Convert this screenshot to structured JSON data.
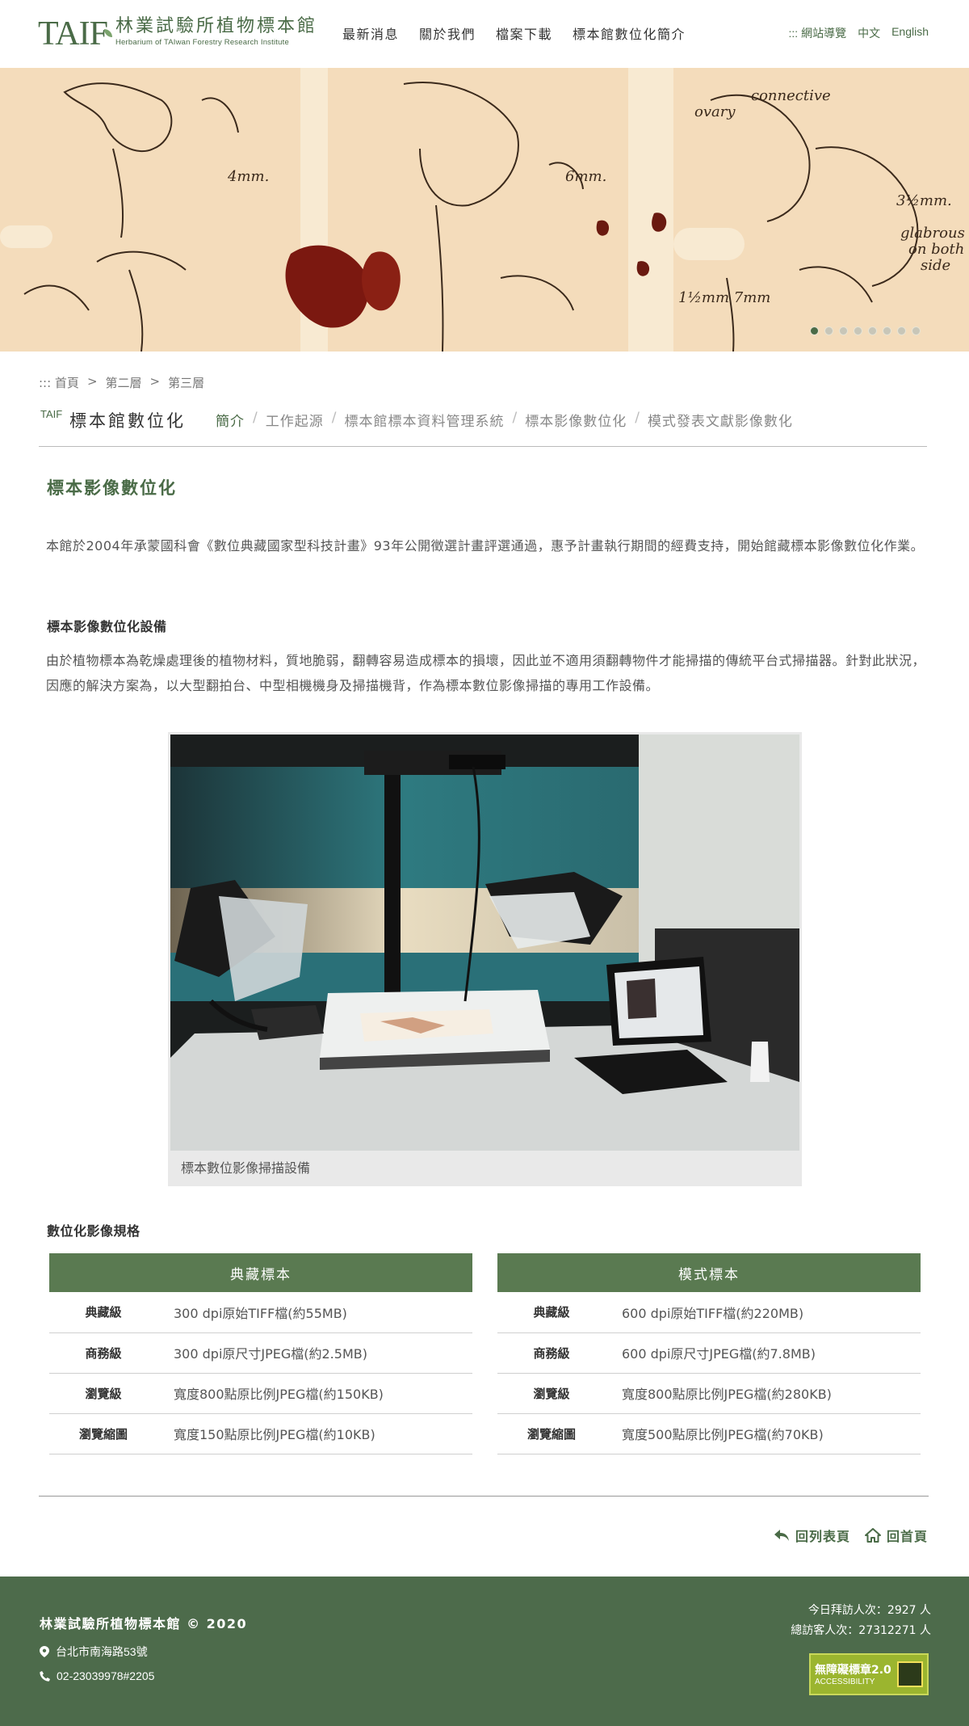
{
  "header": {
    "logo_mark": "TAIF",
    "logo_cn": "林業試驗所植物標本館",
    "logo_en": "Herbarium of TAIwan Forestry Research Institute",
    "nav": [
      "最新消息",
      "關於我們",
      "檔案下載",
      "標本館數位化簡介"
    ],
    "top_links": [
      ":::  網站導覽",
      "中文",
      "English"
    ]
  },
  "banner": {
    "slide_count": 8,
    "active_slide": 1
  },
  "breadcrumb": [
    ":::  首頁",
    ">",
    "第二層",
    ">",
    "第三層"
  ],
  "section": {
    "tag": "TAIF",
    "title": "標本館數位化",
    "tabs": [
      "簡介",
      "工作起源",
      "標本館標本資料管理系統",
      "標本影像數位化",
      "模式發表文獻影像數化"
    ],
    "active_tab": 0
  },
  "content": {
    "heading": "標本影像數位化",
    "para1": "本館於2004年承蒙國科會《數位典藏國家型科技計畫》93年公開徵選計畫評選通過，惠予計畫執行期間的經費支持，開始館藏標本影像數位化作業。",
    "sub1": "標本影像數位化設備",
    "para2": "由於植物標本為乾燥處理後的植物材料，質地脆弱，翻轉容易造成標本的損壞，因此並不適用須翻轉物件才能掃描的傳統平台式掃描器。針對此狀況，因應的解決方案為，以大型翻拍台、中型相機機身及掃描機背，作為標本數位影像掃描的專用工作設備。",
    "caption": "標本數位影像掃描設備",
    "sub2": "數位化影像規格"
  },
  "tables": {
    "left": {
      "title": "典藏標本",
      "rows": [
        [
          "典藏級",
          "300 dpi原始TIFF檔(約55MB)"
        ],
        [
          "商務級",
          "300 dpi原尺寸JPEG檔(約2.5MB)"
        ],
        [
          "瀏覽級",
          "寬度800點原比例JPEG檔(約150KB)"
        ],
        [
          "瀏覽縮圖",
          "寬度150點原比例JPEG檔(約10KB)"
        ]
      ]
    },
    "right": {
      "title": "模式標本",
      "rows": [
        [
          "典藏級",
          "600 dpi原始TIFF檔(約220MB)"
        ],
        [
          "商務級",
          "600 dpi原尺寸JPEG檔(約7.8MB)"
        ],
        [
          "瀏覽級",
          "寬度800點原比例JPEG檔(約280KB)"
        ],
        [
          "瀏覽縮圖",
          "寬度500點原比例JPEG檔(約70KB)"
        ]
      ]
    }
  },
  "back": {
    "list": "回列表頁",
    "home": "回首頁"
  },
  "footer": {
    "org": "林業試驗所植物標本館 © 2020",
    "address": "台北市南海路53號",
    "phone": "02-23039978#2205",
    "today": "今日拜訪人次：2927 人",
    "total": "總訪客人次：27312271 人",
    "badge_line1": "無障礙標章2.0",
    "badge_line2": "ACCESSIBILITY"
  },
  "colors": {
    "brand": "#4a6b47",
    "table_header": "#5a7a51",
    "footer_bg": "#4d6b4b"
  }
}
